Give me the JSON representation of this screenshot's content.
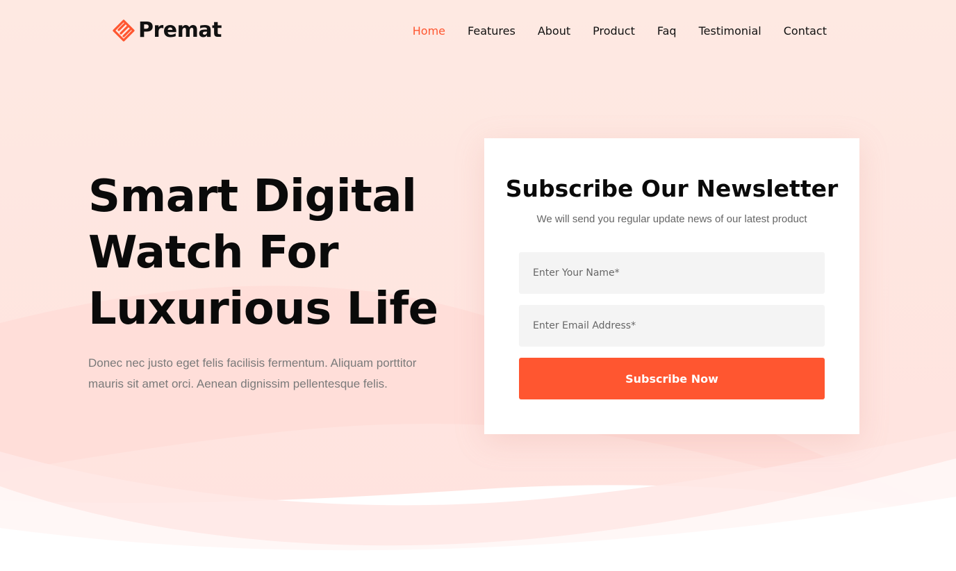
{
  "brand": {
    "name": "Premat",
    "icon": "logo-icon",
    "accent_color": "#ff5630"
  },
  "nav": {
    "items": [
      {
        "label": "Home",
        "active": true
      },
      {
        "label": "Features",
        "active": false
      },
      {
        "label": "About",
        "active": false
      },
      {
        "label": "Product",
        "active": false
      },
      {
        "label": "Faq",
        "active": false
      },
      {
        "label": "Testimonial",
        "active": false
      },
      {
        "label": "Contact",
        "active": false
      }
    ]
  },
  "hero": {
    "title_line1": "Smart Digital",
    "title_line2": "Watch For",
    "title_line3": "Luxurious Life",
    "description": "Donec nec justo eget felis facilisis fermentum. Aliquam porttitor mauris sit amet orci. Aenean dignissim pellentesque felis."
  },
  "newsletter": {
    "title": "Subscribe Our Newsletter",
    "subtitle": "We will send you regular update news of our latest product",
    "name_placeholder": "Enter Your Name*",
    "email_placeholder": "Enter Email Address*",
    "button_label": "Subscribe Now"
  }
}
